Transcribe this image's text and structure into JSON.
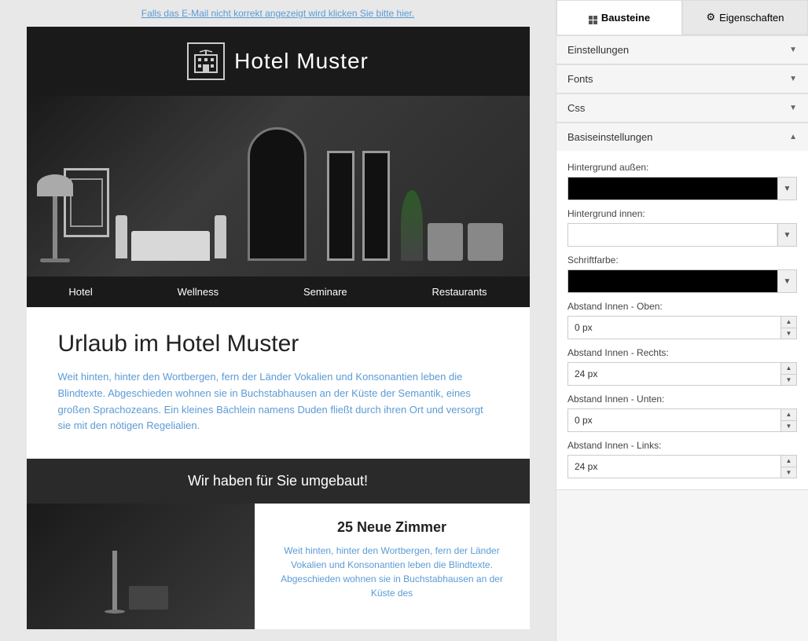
{
  "preview": {
    "link_bar": "Falls das E-Mail nicht korrekt angezeigt wird klicken Sie bitte hier.",
    "hotel_name": "Hotel Muster",
    "nav_items": [
      "Hotel",
      "Wellness",
      "Seminare",
      "Restaurants"
    ],
    "content_heading": "Urlaub im Hotel Muster",
    "content_body": "Weit hinten, hinter den Wortbergen, fern der Länder Vokalien und Konsonantien leben die Blindtexte. Abgeschieden wohnen sie in Buchstabhausen an der Küste der Semantik, eines großen Sprachozeans. Ein kleines Bächlein namens Duden fließt durch ihren Ort und versorgt sie mit den nötigen Regelialien.",
    "promo_text": "Wir haben für Sie umgebaut!",
    "room_heading": "25 Neue Zimmer",
    "room_body": "Weit hinten, hinter den Wortbergen, fern der Länder Vokalien und Konsonantien leben die Blindtexte. Abgeschieden wohnen sie in Buchstabhausen an der Küste des"
  },
  "panel": {
    "tab_bausteine": "Bausteine",
    "tab_eigenschaften": "Eigenschaften",
    "sections": {
      "einstellungen": {
        "label": "Einstellungen",
        "expanded": false
      },
      "fonts": {
        "label": "Fonts",
        "expanded": false
      },
      "css": {
        "label": "Css",
        "expanded": false
      },
      "basiseinstellungen": {
        "label": "Basiseinstellungen",
        "expanded": true
      }
    },
    "fields": {
      "hintergrund_aussen_label": "Hintergrund außen:",
      "hintergrund_innen_label": "Hintergrund innen:",
      "schriftfarbe_label": "Schriftfarbe:",
      "abstand_oben_label": "Abstand Innen - Oben:",
      "abstand_rechts_label": "Abstand Innen - Rechts:",
      "abstand_unten_label": "Abstand Innen - Unten:",
      "abstand_links_label": "Abstand Innen - Links:",
      "abstand_oben_value": "0 px",
      "abstand_rechts_value": "24 px",
      "abstand_unten_value": "0 px",
      "abstand_links_value": "24 px"
    }
  }
}
